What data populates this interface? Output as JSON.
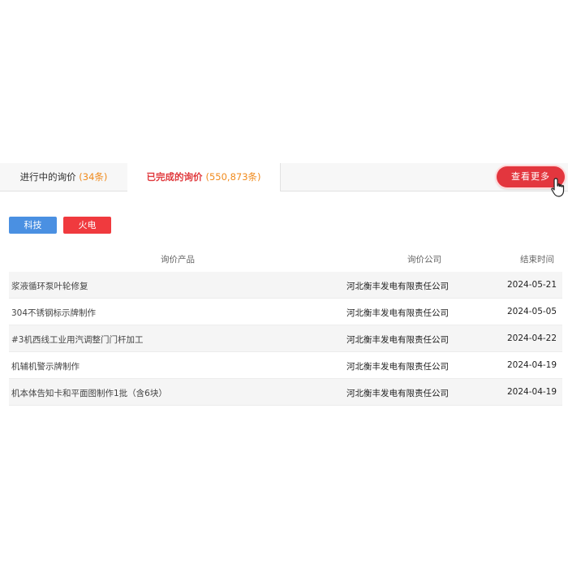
{
  "tabs": [
    {
      "label": "进行中的询价",
      "count": "(34条)"
    },
    {
      "label": "已完成的询价",
      "count": "(550,873条)"
    }
  ],
  "more_button": "查看更多",
  "tags": [
    "科技",
    "火电"
  ],
  "table": {
    "headers": [
      "询价产品",
      "询价公司",
      "结束时间"
    ],
    "rows": [
      {
        "product": "浆液循环泵叶轮修复",
        "company": "河北衡丰发电有限责任公司",
        "date": "2024-05-21"
      },
      {
        "product": "304不锈钢标示牌制作",
        "company": "河北衡丰发电有限责任公司",
        "date": "2024-05-05"
      },
      {
        "product": "#3机西线工业用汽调整门门杆加工",
        "company": "河北衡丰发电有限责任公司",
        "date": "2024-04-22"
      },
      {
        "product": "机辅机警示牌制作",
        "company": "河北衡丰发电有限责任公司",
        "date": "2024-04-19"
      },
      {
        "product": "机本体告知卡和平面图制作1批（含6块）",
        "company": "河北衡丰发电有限责任公司",
        "date": "2024-04-19"
      }
    ]
  }
}
